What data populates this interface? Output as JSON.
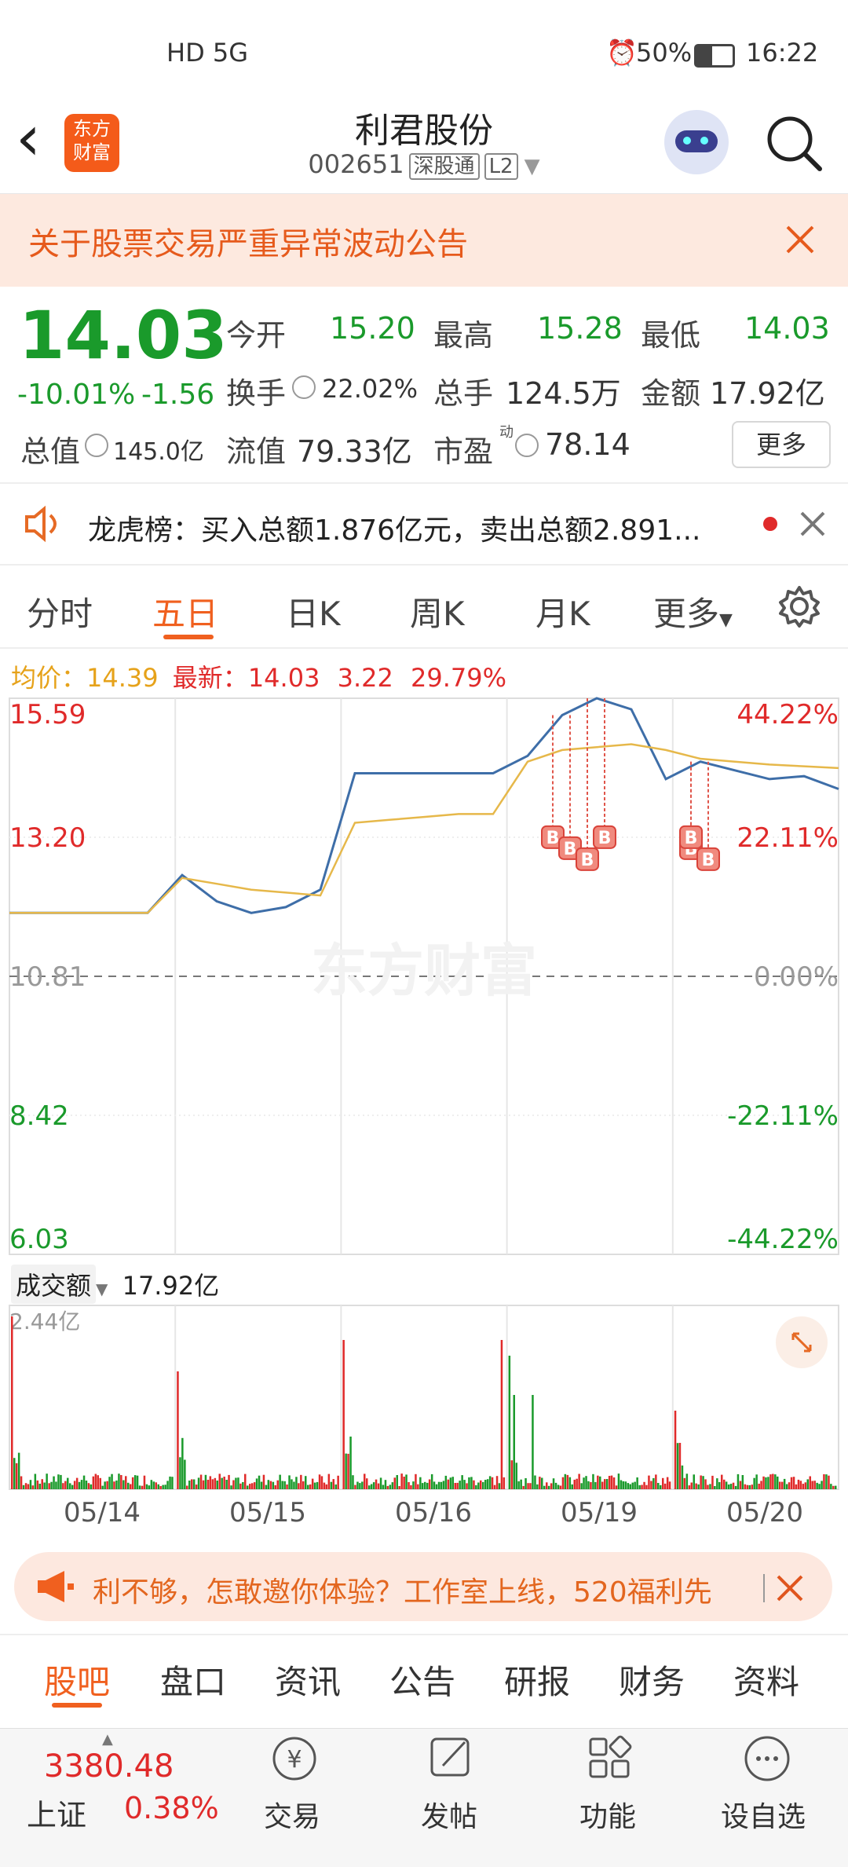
{
  "status": {
    "left_icons": "HD 5G",
    "alarm": "⏰",
    "battery": "50%",
    "time": "16:22"
  },
  "header": {
    "back_icon": "‹",
    "logo": [
      "东方",
      "财富"
    ],
    "name": "利君股份",
    "code": "002651",
    "tag1": "深股通",
    "tag2": "L2"
  },
  "banner": {
    "text": "关于股票交易严重异常波动公告"
  },
  "quote": {
    "price": "14.03",
    "change_pct": "-10.01%",
    "change": "-1.56",
    "open_label": "今开",
    "open": "15.20",
    "high_label": "最高",
    "high": "15.28",
    "low_label": "最低",
    "low": "14.03",
    "turnover_label": "换手",
    "turnover": "22.02%",
    "volume_label": "总手",
    "volume": "124.5万",
    "amount_label": "金额",
    "amount": "17.92亿",
    "mcap_label": "总值",
    "mcap": "145.0亿",
    "float_label": "流值",
    "float": "79.33亿",
    "pe_label": "市盈",
    "pe_sup": "动",
    "pe": "78.14",
    "more": "更多"
  },
  "notice": {
    "text": "龙虎榜：买入总额1.876亿元，卖出总额2.891..."
  },
  "tabs": {
    "items": [
      "分时",
      "五日",
      "日K",
      "周K",
      "月K"
    ],
    "active": "五日",
    "more": "更多"
  },
  "legend": {
    "avg_label": "均价：",
    "avg": "14.39",
    "latest_label": "最新：",
    "latest": "14.03",
    "v1": "3.22",
    "v2": "29.79%"
  },
  "chart_data": {
    "type": "line",
    "x": [
      "05/14",
      "05/15",
      "05/16",
      "05/19",
      "05/20"
    ],
    "y_left_ticks": [
      "15.59",
      "13.20",
      "10.81",
      "8.42",
      "6.03"
    ],
    "y_right_ticks": [
      "44.22%",
      "22.11%",
      "0.00%",
      "-22.11%",
      "-44.22%"
    ],
    "ylim": [
      6.03,
      15.59
    ],
    "reference": 10.81,
    "series": [
      {
        "values": [
          11.9,
          11.9,
          11.9,
          11.9,
          11.9,
          12.55,
          12.1,
          11.9,
          12.0,
          12.3,
          14.3,
          14.3,
          14.3,
          14.3,
          14.3,
          14.6,
          15.3,
          15.59,
          15.4,
          14.2,
          14.5,
          14.35,
          14.2,
          14.25,
          14.03
        ]
      },
      {
        "values": [
          11.9,
          11.9,
          11.9,
          11.9,
          11.9,
          12.5,
          12.4,
          12.3,
          12.25,
          12.2,
          13.45,
          13.5,
          13.55,
          13.6,
          13.6,
          14.5,
          14.7,
          14.75,
          14.8,
          14.7,
          14.55,
          14.5,
          14.45,
          14.42,
          14.39
        ]
      }
    ],
    "markers": [
      "B",
      "B",
      "B",
      "B",
      "B",
      "B",
      "B"
    ],
    "watermark": "东方财富"
  },
  "volume": {
    "title": "成交额",
    "value": "17.92亿",
    "max_label": "2.44亿"
  },
  "ad": {
    "text": "利不够，怎敢邀你体验？工作室上线，520福利先"
  },
  "bottom_tabs": [
    "股吧",
    "盘口",
    "资讯",
    "公告",
    "研报",
    "财务",
    "资料"
  ],
  "index": {
    "value": "3380.48",
    "name": "上证",
    "pct": "0.38%"
  },
  "nav": [
    {
      "label": "交易",
      "icon": "trade-icon"
    },
    {
      "label": "发帖",
      "icon": "post-icon"
    },
    {
      "label": "功能",
      "icon": "grid-icon"
    },
    {
      "label": "设自选",
      "icon": "add-watch-icon"
    }
  ]
}
